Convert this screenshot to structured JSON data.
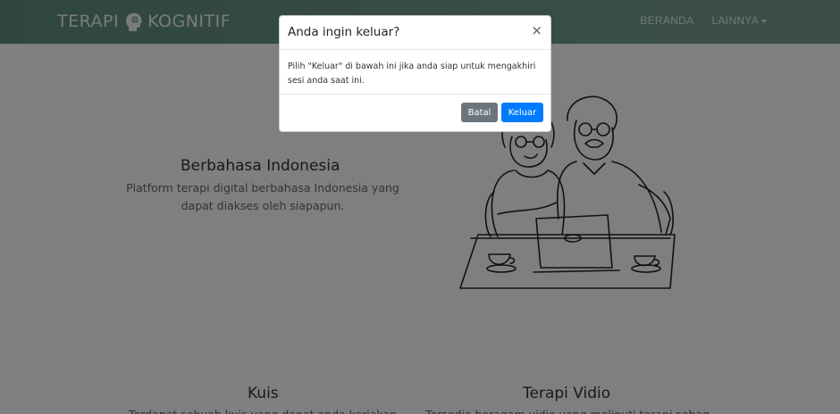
{
  "navbar": {
    "brand_left": "TERAPI",
    "brand_right": "KOGNITIF",
    "links": [
      {
        "label": "BERANDA"
      },
      {
        "label": "LAINNYA"
      }
    ]
  },
  "hero": {
    "title": "Berbahasa Indonesia",
    "text": "Platform terapi digital berbahasa Indonesia yang dapat diakses oleh siapapun."
  },
  "features": [
    {
      "title": "Kuis",
      "text": "Terdapat sebuah kuis yang dapat anda kerjakan"
    },
    {
      "title": "Terapi Vidio",
      "text": "Tersedia beragam vidio yang meliputi terapi sebag"
    }
  ],
  "modal": {
    "title": "Anda ingin keluar?",
    "close": "×",
    "body": "Pilih \"Keluar\" di bawah ini jika anda siap untuk mengakhiri sesi anda saat ini.",
    "cancel_label": "Batal",
    "confirm_label": "Keluar"
  },
  "colors": {
    "navbar": "#6f9a88",
    "primary_button": "#007bff",
    "secondary_button": "#6c757d",
    "backdrop": "rgba(0,0,0,0.5)"
  }
}
